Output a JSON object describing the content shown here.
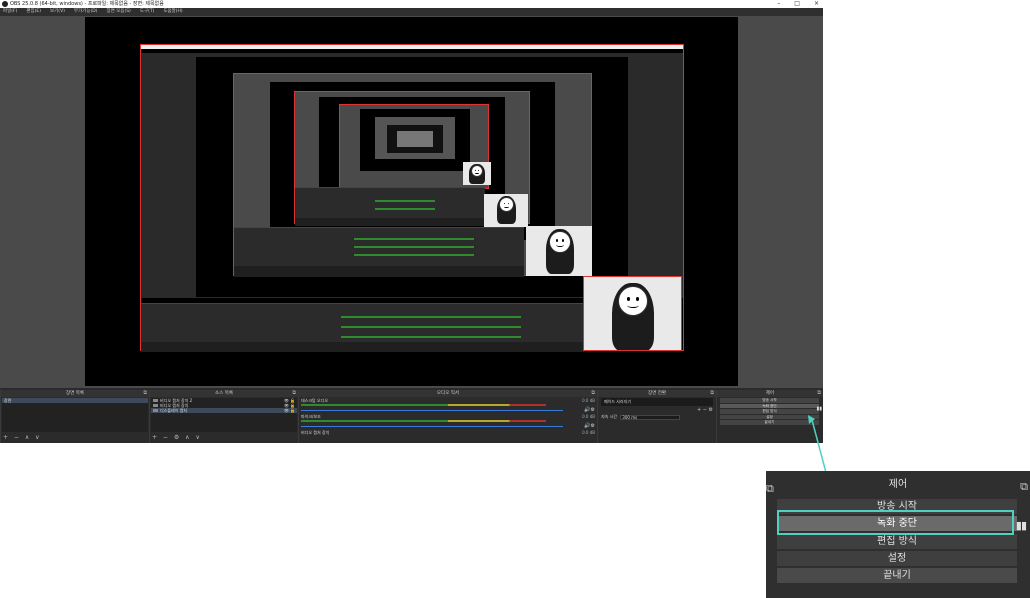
{
  "window": {
    "title": "OBS 25.0.8 (64-bit, windows) - 프로파일: 제목없음 - 장면: 제목없음",
    "minimize": "–",
    "maximize": "□",
    "close": "×"
  },
  "menu": [
    "파일(F)",
    "편집(E)",
    "보기(V)",
    "부가기능(D)",
    "장면 모음(S)",
    "도구(T)",
    "도움말(H)"
  ],
  "docks": {
    "scenes": {
      "title": "장면 목록",
      "items": [
        "장면"
      ],
      "footer": "+ − ∧ ∨"
    },
    "sources": {
      "title": "소스 목록",
      "items": [
        "비디오 캡처 장치 2",
        "비디오 캡처 장치",
        "디스플레이 캡처"
      ],
      "footer": "+ − ⚙ ∧ ∨"
    },
    "mixer": {
      "title": "오디오 믹서",
      "tracks": [
        {
          "name": "데스크탑 오디오",
          "db": "0.0 dB"
        },
        {
          "name": "마이크/보조",
          "db": "0.0 dB"
        },
        {
          "name": "비디오 캡처 장치",
          "db": "0.0 dB"
        }
      ]
    },
    "transitions": {
      "title": "장면 전환",
      "type": "페이드 사라지기",
      "duration_label": "지속 시간",
      "duration_value": "300 ms",
      "footer": "+ − ⚙"
    },
    "controls": {
      "title": "제어",
      "buttons": [
        "방송 시작",
        "녹화 중단",
        "편집 방식",
        "설정",
        "끝내기"
      ]
    }
  },
  "zoom": {
    "title": "제어",
    "buttons": [
      "방송 시작",
      "녹화 중단",
      "편집 방식",
      "설정",
      "끝내기"
    ],
    "pause_icon": "▮▮",
    "undock_icon": "⧉"
  },
  "colors": {
    "highlight": "#4fd1c0",
    "selection_border": "#dd3333"
  }
}
